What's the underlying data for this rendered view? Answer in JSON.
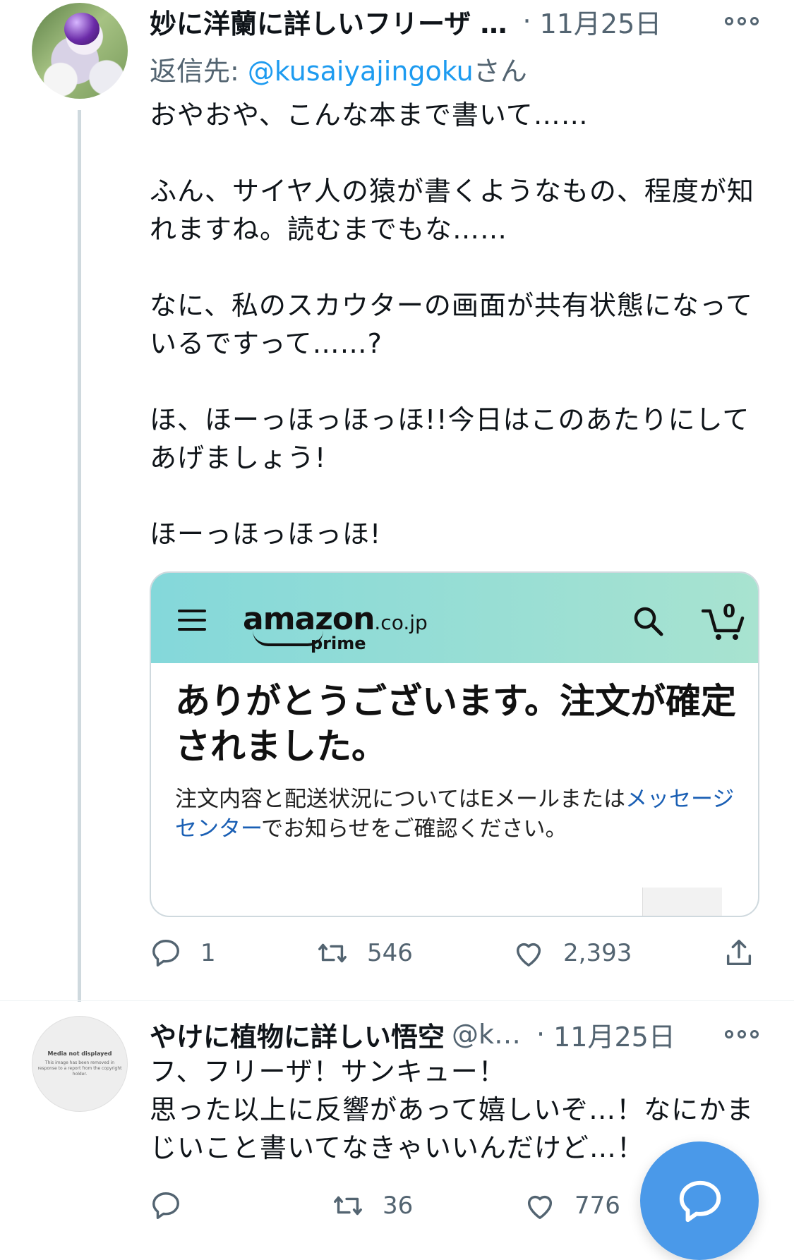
{
  "tweet1": {
    "name": "妙に洋蘭に詳しいフリーザ …",
    "dot": "·",
    "time": "11月25日",
    "reply_prefix": "返信先: ",
    "reply_mention": "@kusaiyajingoku",
    "reply_suffix": "さん",
    "text": "おやおや、こんな本まで書いて……\n\nふん、サイヤ人の猿が書くようなもの、程度が知れますね。読むまでもな……\n\nなに、私のスカウターの画面が共有状態になっているですって……?\n\nほ、ほーっほっほっほ!!今日はこのあたりにしてあげましょう!\n\nほーっほっほっほ!",
    "card": {
      "logo_main": "amazon",
      "logo_domain": ".co.jp",
      "logo_sub": "prime",
      "cart_count": "0",
      "headline": "ありがとうございます。注文が確定されました。",
      "note_before": "注文内容と配送状況についてはEメールまたは",
      "note_link": "メッセージセンター",
      "note_after": "でお知らせをご確認ください。"
    },
    "actions": {
      "replies": "1",
      "retweets": "546",
      "likes": "2,393"
    }
  },
  "tweet2": {
    "avatar_title": "Media not displayed",
    "avatar_desc": "This image has been removed in response to a report from the copyright holder.",
    "name": "やけに植物に詳しい悟空",
    "handle": "@k…",
    "dot": "·",
    "time": "11月25日",
    "text": "フ、フリーザ！サンキュー！\n思った以上に反響があって嬉しいぞ…！なにかまじいこと書いてなきゃいいんだけど…！",
    "actions": {
      "retweets": "36",
      "likes": "776"
    }
  },
  "icons": {
    "reply": "reply-icon",
    "retweet": "retweet-icon",
    "like": "heart-icon",
    "share": "share-icon",
    "more": "more-icon",
    "compose": "compose-reply-icon"
  },
  "colors": {
    "accent": "#1d9bf0",
    "fab": "#4a99e9",
    "secondary": "#536471"
  }
}
